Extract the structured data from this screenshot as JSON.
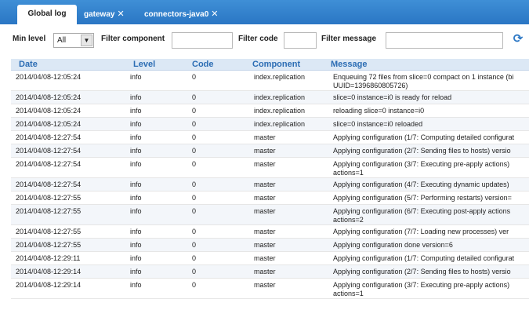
{
  "tabs": [
    {
      "label": "Global log",
      "closable": false
    },
    {
      "label": "gateway",
      "closable": true
    },
    {
      "label": "connectors-java0",
      "closable": true
    }
  ],
  "filters": {
    "min_level_label": "Min level",
    "min_level_value": "All",
    "component_label": "Filter component",
    "code_label": "Filter code",
    "message_label": "Filter message",
    "component_value": "",
    "code_value": "",
    "message_value": ""
  },
  "columns": {
    "date": "Date",
    "level": "Level",
    "code": "Code",
    "component": "Component",
    "message": "Message"
  },
  "rows": [
    {
      "date": "2014/04/08-12:05:24",
      "level": "info",
      "code": "0",
      "component": "index.replication",
      "message": "Enqueuing 72 files from slice=0 compact on 1 instance (bi UUID=1396860805726)",
      "tall": true
    },
    {
      "date": "2014/04/08-12:05:24",
      "level": "info",
      "code": "0",
      "component": "index.replication",
      "message": "slice=0 instance=i0 is ready for reload",
      "tall": false
    },
    {
      "date": "2014/04/08-12:05:24",
      "level": "info",
      "code": "0",
      "component": "index.replication",
      "message": "reloading slice=0 instance=i0",
      "tall": false
    },
    {
      "date": "2014/04/08-12:05:24",
      "level": "info",
      "code": "0",
      "component": "index.replication",
      "message": "slice=0 instance=i0 reloaded",
      "tall": false
    },
    {
      "date": "2014/04/08-12:27:54",
      "level": "info",
      "code": "0",
      "component": "master",
      "message": "Applying configuration (1/7: Computing detailed configurat",
      "tall": false
    },
    {
      "date": "2014/04/08-12:27:54",
      "level": "info",
      "code": "0",
      "component": "master",
      "message": "Applying configuration (2/7: Sending files to hosts) versio",
      "tall": false
    },
    {
      "date": "2014/04/08-12:27:54",
      "level": "info",
      "code": "0",
      "component": "master",
      "message": "Applying configuration (3/7: Executing pre-apply actions) actions=1",
      "tall": true
    },
    {
      "date": "2014/04/08-12:27:54",
      "level": "info",
      "code": "0",
      "component": "master",
      "message": "Applying configuration (4/7: Executing dynamic updates)",
      "tall": false
    },
    {
      "date": "2014/04/08-12:27:55",
      "level": "info",
      "code": "0",
      "component": "master",
      "message": "Applying configuration (5/7: Performing restarts) version=",
      "tall": false
    },
    {
      "date": "2014/04/08-12:27:55",
      "level": "info",
      "code": "0",
      "component": "master",
      "message": "Applying configuration (6/7: Executing post-apply actions actions=2",
      "tall": true
    },
    {
      "date": "2014/04/08-12:27:55",
      "level": "info",
      "code": "0",
      "component": "master",
      "message": "Applying configuration (7/7: Loading new processes) ver",
      "tall": false
    },
    {
      "date": "2014/04/08-12:27:55",
      "level": "info",
      "code": "0",
      "component": "master",
      "message": "Applying configuration done version=6",
      "tall": false
    },
    {
      "date": "2014/04/08-12:29:11",
      "level": "info",
      "code": "0",
      "component": "master",
      "message": "Applying configuration (1/7: Computing detailed configurat",
      "tall": false
    },
    {
      "date": "2014/04/08-12:29:14",
      "level": "info",
      "code": "0",
      "component": "master",
      "message": "Applying configuration (2/7: Sending files to hosts) versio",
      "tall": false
    },
    {
      "date": "2014/04/08-12:29:14",
      "level": "info",
      "code": "0",
      "component": "master",
      "message": "Applying configuration (3/7: Executing pre-apply actions) actions=1",
      "tall": true
    }
  ],
  "colors": {
    "tabbar": "#2a76c4",
    "header_text": "#2c6db4",
    "header_bg": "#dce8f5"
  }
}
